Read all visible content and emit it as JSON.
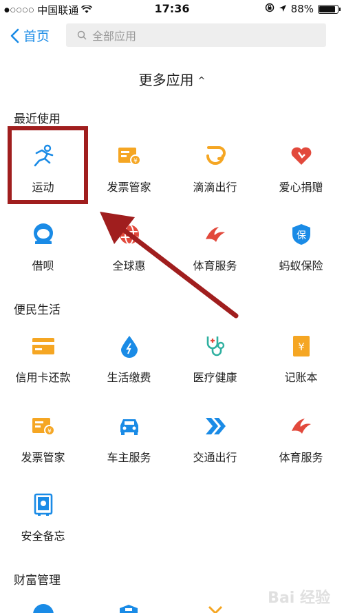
{
  "status_bar": {
    "signal_dots": "●○○○○",
    "carrier": "中国联通",
    "time": "17:36",
    "battery_percent": "88%",
    "battery_level": 0.88
  },
  "nav": {
    "back_label": "首页",
    "search_placeholder": "全部应用"
  },
  "toggle": {
    "label": "更多应用",
    "caret": "^"
  },
  "sections": {
    "recent": {
      "title": "最近使用",
      "items": [
        "运动",
        "发票管家",
        "滴滴出行",
        "爱心捐赠",
        "借呗",
        "全球惠",
        "体育服务",
        "蚂蚁保险"
      ]
    },
    "life": {
      "title": "便民生活",
      "items": [
        "信用卡还款",
        "生活缴费",
        "医疗健康",
        "记账本",
        "发票管家",
        "车主服务",
        "交通出行",
        "体育服务",
        "安全备忘"
      ]
    },
    "wealth": {
      "title": "财富管理"
    }
  },
  "watermark": "Bai 经验",
  "colors": {
    "accent_blue": "#1a8be6",
    "orange": "#f5a623",
    "red": "#e2493c",
    "teal": "#2fb0a0",
    "highlight": "#a01e1e"
  }
}
